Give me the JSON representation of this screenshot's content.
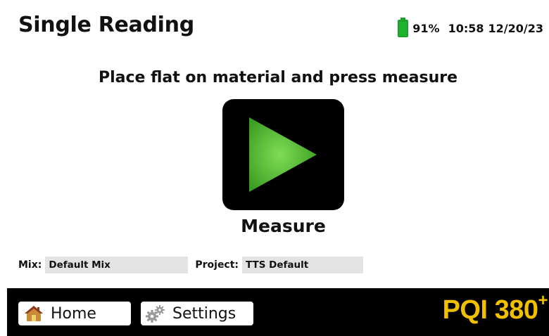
{
  "header": {
    "title": "Single Reading",
    "battery_percent": "91%",
    "time": "10:58",
    "date": "12/20/23"
  },
  "main": {
    "instruction": "Place flat on material and press measure",
    "measure_label": "Measure"
  },
  "fields": {
    "mix_label": "Mix:",
    "mix_value": "Default Mix",
    "project_label": "Project:",
    "project_value": "TTS Default"
  },
  "footer": {
    "home_label": "Home",
    "settings_label": "Settings",
    "brand": "PQI 380",
    "brand_sup": "+"
  },
  "colors": {
    "battery": "#1db32c",
    "play_button": "#4fb531",
    "brand": "#f0bf00",
    "footer_bg": "#000000"
  },
  "icons": {
    "battery": "battery-icon",
    "measure": "play-icon",
    "home": "house-icon",
    "settings": "gears-icon"
  }
}
